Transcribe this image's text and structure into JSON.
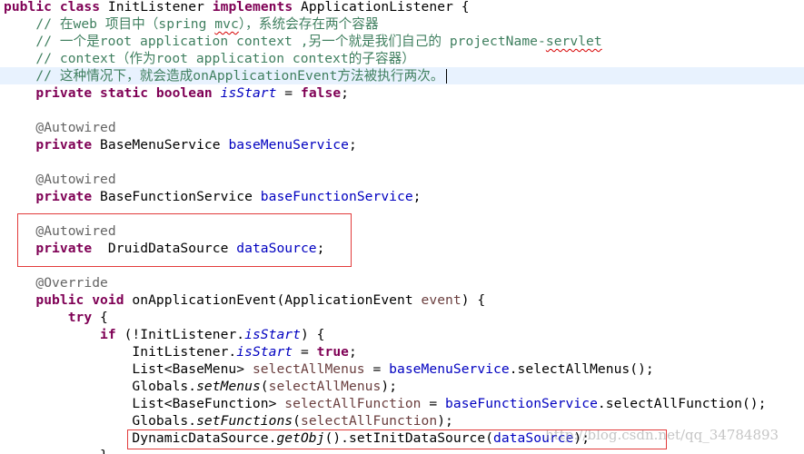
{
  "code": {
    "l1": {
      "kw1": "public",
      "kw2": "class",
      "name": "InitListener",
      "kw3": "implements",
      "iface": "ApplicationListener",
      "brace": " {"
    },
    "l2": {
      "c1": "// 在web 项目中（spring ",
      "sq": "mvc",
      "c2": "），系统会存在两个容器"
    },
    "l3": {
      "c": "// 一个是root application context ,另一个就是我们自己的 projectName-",
      "sq": "servlet"
    },
    "l4": {
      "c": "// context（作为root application context的子容器）"
    },
    "l5": {
      "c": "// 这种情况下，就会造成onApplicationEvent方法被执行两次。"
    },
    "l6": {
      "kw": "private static boolean",
      "field": "isStart",
      "mid": " = ",
      "val": "false",
      "end": ";"
    },
    "l8": {
      "an": "@Autowired"
    },
    "l9": {
      "kw": "private",
      "type": " BaseMenuService ",
      "field": "baseMenuService",
      "end": ";"
    },
    "l11": {
      "an": "@Autowired"
    },
    "l12": {
      "kw": "private",
      "type": " BaseFunctionService ",
      "field": "baseFunctionService",
      "end": ";"
    },
    "l14": {
      "an": "@Autowired"
    },
    "l15": {
      "kw": "private",
      "type": "  DruidDataSource ",
      "field": "dataSource",
      "end": ";"
    },
    "l17": {
      "an": "@Override"
    },
    "l18": {
      "kw": "public void",
      "sig": " onApplicationEvent(ApplicationEvent ",
      "param": "event",
      "end": ") {"
    },
    "l19": {
      "kw": "try",
      "end": " {"
    },
    "l20": {
      "kw": "if",
      "pre": " (!InitListener.",
      "field": "isStart",
      "end": ") {"
    },
    "l21": {
      "pre": "InitListener.",
      "field": "isStart",
      "mid": " = ",
      "val": "true",
      "end": ";"
    },
    "l22": {
      "type": "List<BaseMenu> ",
      "var": "selectAllMenus",
      "mid": " = ",
      "field": "baseMenuService",
      "call": ".selectAllMenus();"
    },
    "l23": {
      "pre": "Globals.",
      "method": "setMenus",
      "open": "(",
      "arg": "selectAllMenus",
      "end": ");"
    },
    "l24": {
      "type": "List<BaseFunction> ",
      "var": "selectAllFunction",
      "mid": " = ",
      "field": "baseFunctionService",
      "call": ".selectAllFunction();"
    },
    "l25": {
      "pre": "Globals.",
      "method": "setFunctions",
      "open": "(",
      "arg": "selectAllFunction",
      "end": ");"
    },
    "l26": {
      "pre": "DynamicDataSource.",
      "method": "getObj",
      "mid": "().setInitDataSource(",
      "field": "dataSource",
      "end": ");"
    },
    "l27": {
      "brace": "}"
    }
  },
  "watermark": "http://blog.csdn.net/qq_34784893",
  "colors": {
    "keyword": "#7f0055",
    "comment": "#3f7f5f",
    "annotation": "#646464",
    "field": "#0000c0",
    "local": "#6a3e3e",
    "highlight_box": "#e23b3b",
    "current_line": "#e8f2fe"
  }
}
